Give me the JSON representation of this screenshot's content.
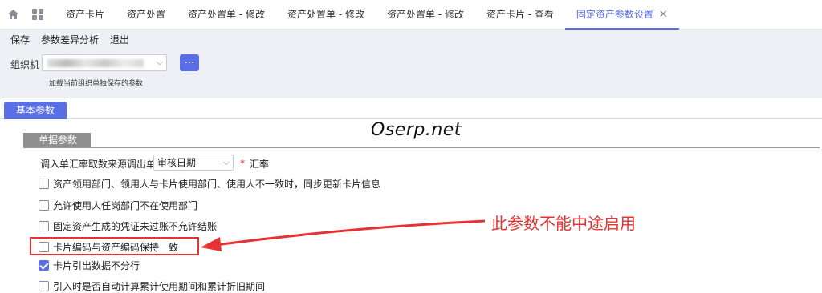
{
  "tabs": [
    {
      "label": "资产卡片"
    },
    {
      "label": "资产处置"
    },
    {
      "label": "资产处置单 - 修改"
    },
    {
      "label": "资产处置单 - 修改"
    },
    {
      "label": "资产处置单 - 修改"
    },
    {
      "label": "资产卡片 - 查看"
    },
    {
      "label": "固定资产参数设置",
      "active": true
    }
  ],
  "toolbar": {
    "save": "保存",
    "diff": "参数差异分析",
    "exit": "退出"
  },
  "org": {
    "label": "组织机",
    "lookup_button": "...",
    "hint": "加载当前组织单独保存的参数"
  },
  "section_tab": "基本参数",
  "group_header": "单据参数",
  "watermark": "Oserp.net",
  "rate": {
    "label": "调入单汇率取数来源调出单",
    "value": "审核日期",
    "required_mark": "*",
    "suffix": "汇率"
  },
  "options": [
    {
      "label": "资产领用部门、领用人与卡片使用部门、使用人不一致时，同步更新卡片信息",
      "checked": false
    },
    {
      "label": "允许使用人任岗部门不在使用部门",
      "checked": false
    },
    {
      "label": "固定资产生成的凭证未过账不允许结账",
      "checked": false
    },
    {
      "label": "卡片编码与资产编码保持一致",
      "checked": false
    },
    {
      "label": "卡片引出数据不分行",
      "checked": true
    },
    {
      "label": "引入时是否自动计算累计使用期间和累计折旧期间",
      "checked": false
    }
  ],
  "annotation": "此参数不能中途启用",
  "colors": {
    "accent": "#5a6ee6",
    "annotation": "#e83232",
    "toolbar_bg": "#eef0f6"
  }
}
